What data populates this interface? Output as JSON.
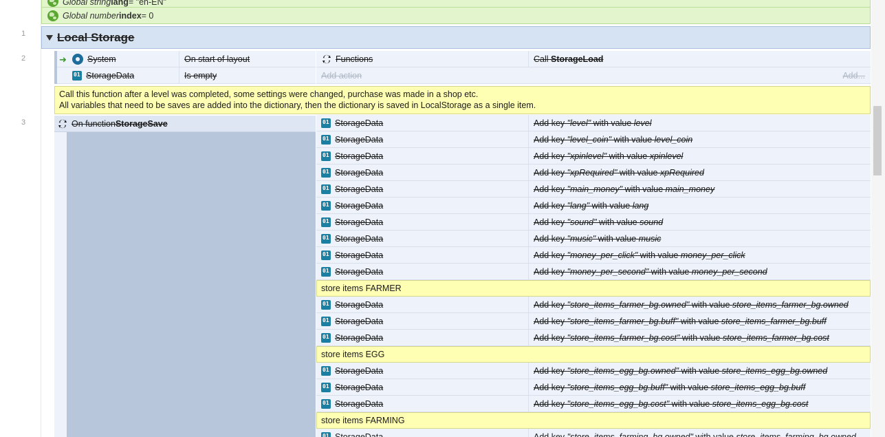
{
  "globals": [
    {
      "prefix": "Global string ",
      "name": "lang",
      "suffix": " = \"en-EN\""
    },
    {
      "prefix": "Global number ",
      "name": "index",
      "suffix": " = 0"
    }
  ],
  "line_numbers": [
    "1",
    "2",
    "3"
  ],
  "group": {
    "title": "Local Storage"
  },
  "event2": {
    "conditions": [
      {
        "object": "System",
        "condition": "On start of layout",
        "icon": "gear-icon",
        "trigger": true
      },
      {
        "object": "StorageData",
        "condition": "Is empty",
        "icon": "dictionary-icon",
        "trigger": false
      }
    ],
    "actions": [
      {
        "object": "Functions",
        "desc_prefix": "Call ",
        "desc_bold": "StorageLoad",
        "icon": "function-icon"
      }
    ],
    "add_action": "Add action",
    "add_more": "Add..."
  },
  "comment1": {
    "line1": "Call this function after a level was completed, some settings were changed, purchase was made in a shop etc.",
    "line2": "All variables that need to be saves are added into the dictionary, then the dictionary is saved in LocalStorage as a single item."
  },
  "event3": {
    "trigger_prefix": "On function ",
    "trigger_name": "StorageSave",
    "rows": [
      {
        "type": "action",
        "object": "StorageData",
        "key": "\"level\"",
        "value": "level"
      },
      {
        "type": "action",
        "object": "StorageData",
        "key": "\"level_coin\"",
        "value": "level_coin"
      },
      {
        "type": "action",
        "object": "StorageData",
        "key": "\"xpinlevel\"",
        "value": "xpinlevel"
      },
      {
        "type": "action",
        "object": "StorageData",
        "key": "\"xpRequired\"",
        "value": "xpRequired"
      },
      {
        "type": "action",
        "object": "StorageData",
        "key": "\"main_money\"",
        "value": "main_money"
      },
      {
        "type": "action",
        "object": "StorageData",
        "key": "\"lang\"",
        "value": "lang"
      },
      {
        "type": "action",
        "object": "StorageData",
        "key": "\"sound\"",
        "value": "sound"
      },
      {
        "type": "action",
        "object": "StorageData",
        "key": "\"music\"",
        "value": "music"
      },
      {
        "type": "action",
        "object": "StorageData",
        "key": "\"money_per_click\"",
        "value": "money_per_click"
      },
      {
        "type": "action",
        "object": "StorageData",
        "key": "\"money_per_second\"",
        "value": "money_per_second"
      },
      {
        "type": "comment",
        "text": "store items FARMER"
      },
      {
        "type": "action",
        "object": "StorageData",
        "key": "\"store_items_farmer_bg.owned\"",
        "value": "store_items_farmer_bg.owned"
      },
      {
        "type": "action",
        "object": "StorageData",
        "key": "\"store_items_farmer_bg.buff\"",
        "value": "store_items_farmer_bg.buff"
      },
      {
        "type": "action",
        "object": "StorageData",
        "key": "\"store_items_farmer_bg.cost\"",
        "value": "store_items_farmer_bg.cost"
      },
      {
        "type": "comment",
        "text": "store items EGG"
      },
      {
        "type": "action",
        "object": "StorageData",
        "key": "\"store_items_egg_bg.owned\"",
        "value": "store_items_egg_bg.owned"
      },
      {
        "type": "action",
        "object": "StorageData",
        "key": "\"store_items_egg_bg.buff\"",
        "value": "store_items_egg_bg.buff"
      },
      {
        "type": "action",
        "object": "StorageData",
        "key": "\"store_items_egg_bg.cost\"",
        "value": "store_items_egg_bg.cost"
      },
      {
        "type": "comment",
        "text": "store items FARMING"
      },
      {
        "type": "action",
        "object": "StorageData",
        "key": "\"store_items_farming_bg.owned\"",
        "value": "store_items_farming_bg.owned"
      }
    ],
    "add_key_prefix": "Add key ",
    "with_value": " with value "
  },
  "colors": {
    "global_bg": "#e3f5cc",
    "group_bg": "#d6e3f3",
    "comment_bg": "#ffffb4",
    "row_bg": "#eef2fa",
    "dict_icon": "#1a7fa3"
  }
}
